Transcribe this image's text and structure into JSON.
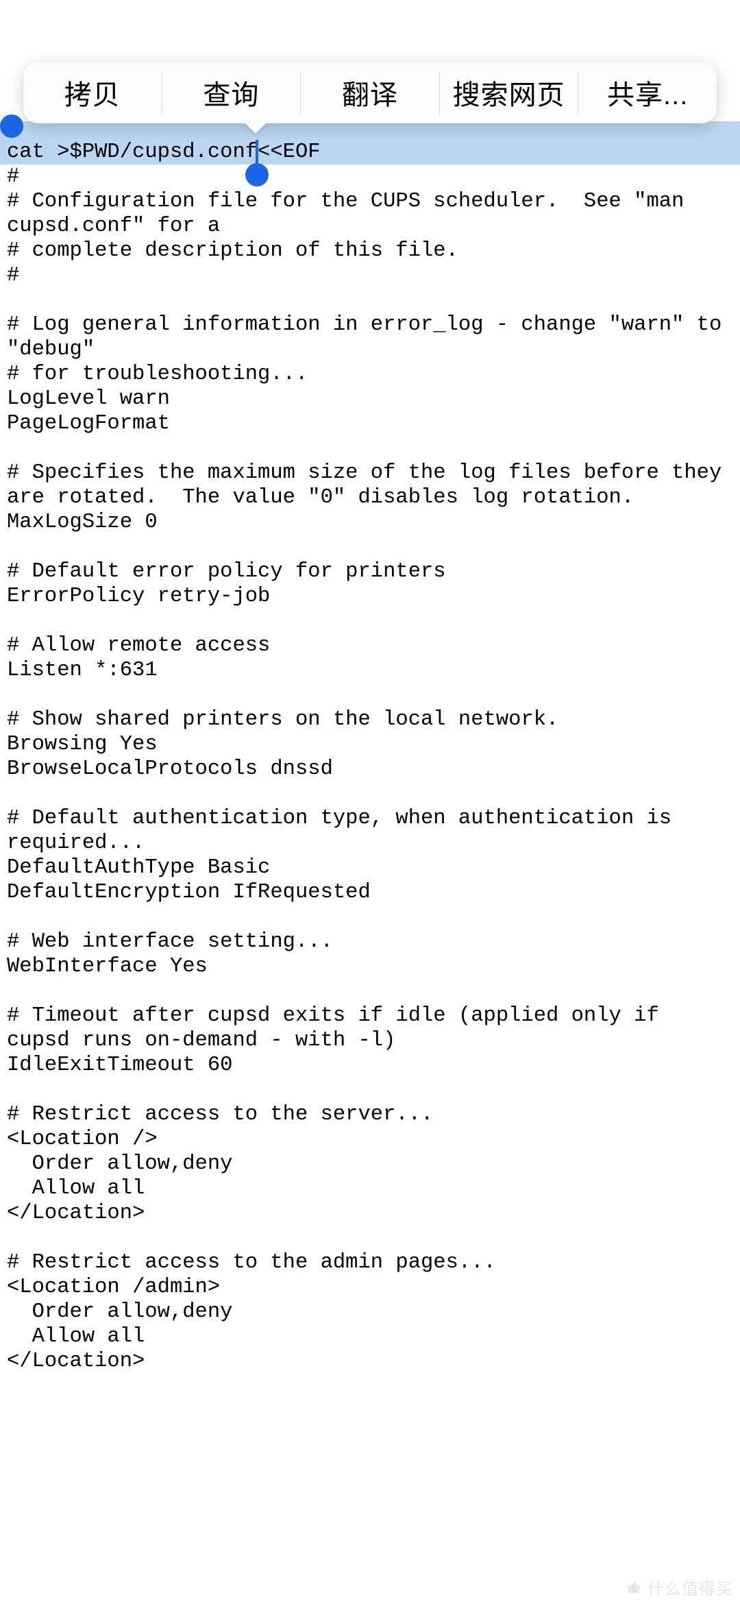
{
  "context_menu": {
    "items": [
      {
        "label": "拷贝"
      },
      {
        "label": "查询"
      },
      {
        "label": "翻译"
      },
      {
        "label": "搜索网页"
      },
      {
        "label": "共享..."
      }
    ]
  },
  "selection": {
    "selected_text": "cat >$PWD/cupsd.conf<<EOF"
  },
  "document": {
    "text": "cat >$PWD/cupsd.conf<<EOF\n#\n# Configuration file for the CUPS scheduler.  See \"man cupsd.conf\" for a\n# complete description of this file.\n#\n\n# Log general information in error_log - change \"warn\" to \"debug\"\n# for troubleshooting...\nLogLevel warn\nPageLogFormat\n\n# Specifies the maximum size of the log files before they are rotated.  The value \"0\" disables log rotation.\nMaxLogSize 0\n\n# Default error policy for printers\nErrorPolicy retry-job\n\n# Allow remote access\nListen *:631\n\n# Show shared printers on the local network.\nBrowsing Yes\nBrowseLocalProtocols dnssd\n\n# Default authentication type, when authentication is required...\nDefaultAuthType Basic\nDefaultEncryption IfRequested\n\n# Web interface setting...\nWebInterface Yes\n\n# Timeout after cupsd exits if idle (applied only if cupsd runs on-demand - with -l)\nIdleExitTimeout 60\n\n# Restrict access to the server...\n<Location />\n  Order allow,deny\n  Allow all\n</Location>\n\n# Restrict access to the admin pages...\n<Location /admin>\n  Order allow,deny\n  Allow all\n</Location>"
  },
  "watermark": {
    "text": "什么值得买"
  }
}
